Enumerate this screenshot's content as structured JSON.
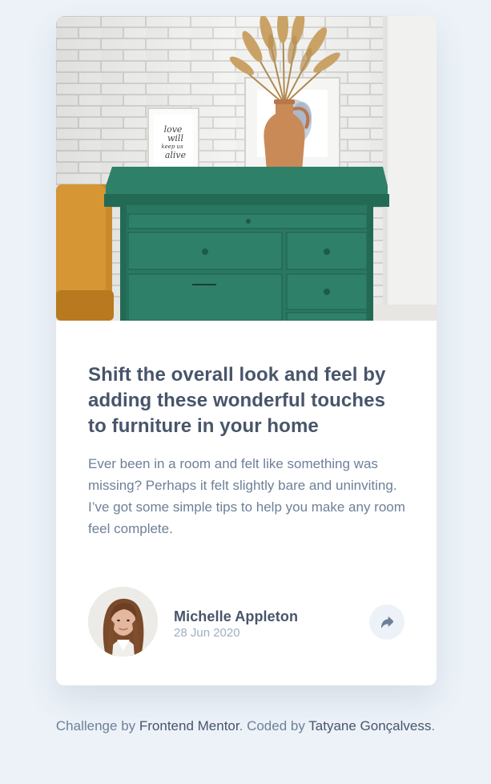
{
  "article": {
    "title": "Shift the overall look and feel by adding these wonderful touches to furniture in your home",
    "excerpt": "Ever been in a room and felt like something was missing? Perhaps it felt slightly bare and uninviting. I’ve got some simple tips to help you make any room feel complete.",
    "image_frame_text": [
      "love",
      "will",
      "keep us",
      "alive"
    ]
  },
  "author": {
    "name": "Michelle Appleton",
    "date": "28 Jun 2020"
  },
  "share": {
    "icon": "share-icon"
  },
  "attribution": {
    "prefix": "Challenge by ",
    "challenge_link": "Frontend Mentor",
    "middle": ". Coded by ",
    "coder_link": "Tatyane Gonçalvess",
    "suffix": "."
  },
  "colors": {
    "background": "#ecf2f8",
    "card": "#ffffff",
    "heading": "#48556a",
    "body_text": "#6e8098",
    "muted_text": "#9eafc2",
    "cabinet": "#2d7a64"
  }
}
